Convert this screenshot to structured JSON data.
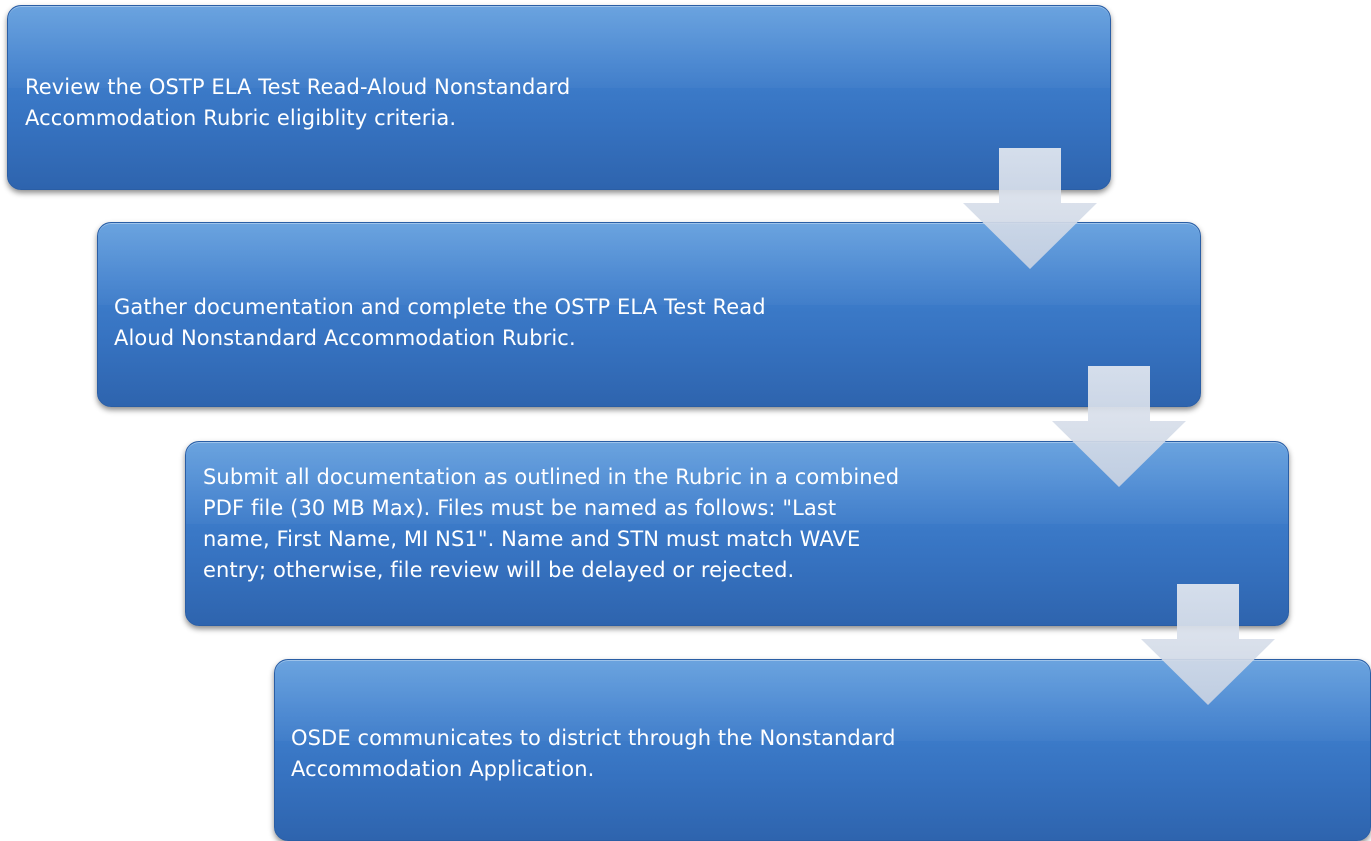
{
  "steps": [
    {
      "text": "Review the OSTP ELA Test Read-Aloud Nonstandard\nAccommodation Rubric eligiblity criteria."
    },
    {
      "text": "Gather documentation and complete the OSTP ELA Test Read\nAloud Nonstandard Accommodation Rubric."
    },
    {
      "text": "Submit all documentation as outlined in the Rubric in a combined\nPDF file (30 MB Max).  Files must be named as follows: \"Last\nname, First Name, MI NS1\".  Name and STN must match WAVE\nentry; otherwise, file review will be delayed or rejected."
    },
    {
      "text": "OSDE communicates to district through the Nonstandard\nAccommodation Application."
    }
  ],
  "colors": {
    "box_fill": "#3a78c6",
    "arrow_fill": "#cfd8e8",
    "text": "#ffffff"
  }
}
